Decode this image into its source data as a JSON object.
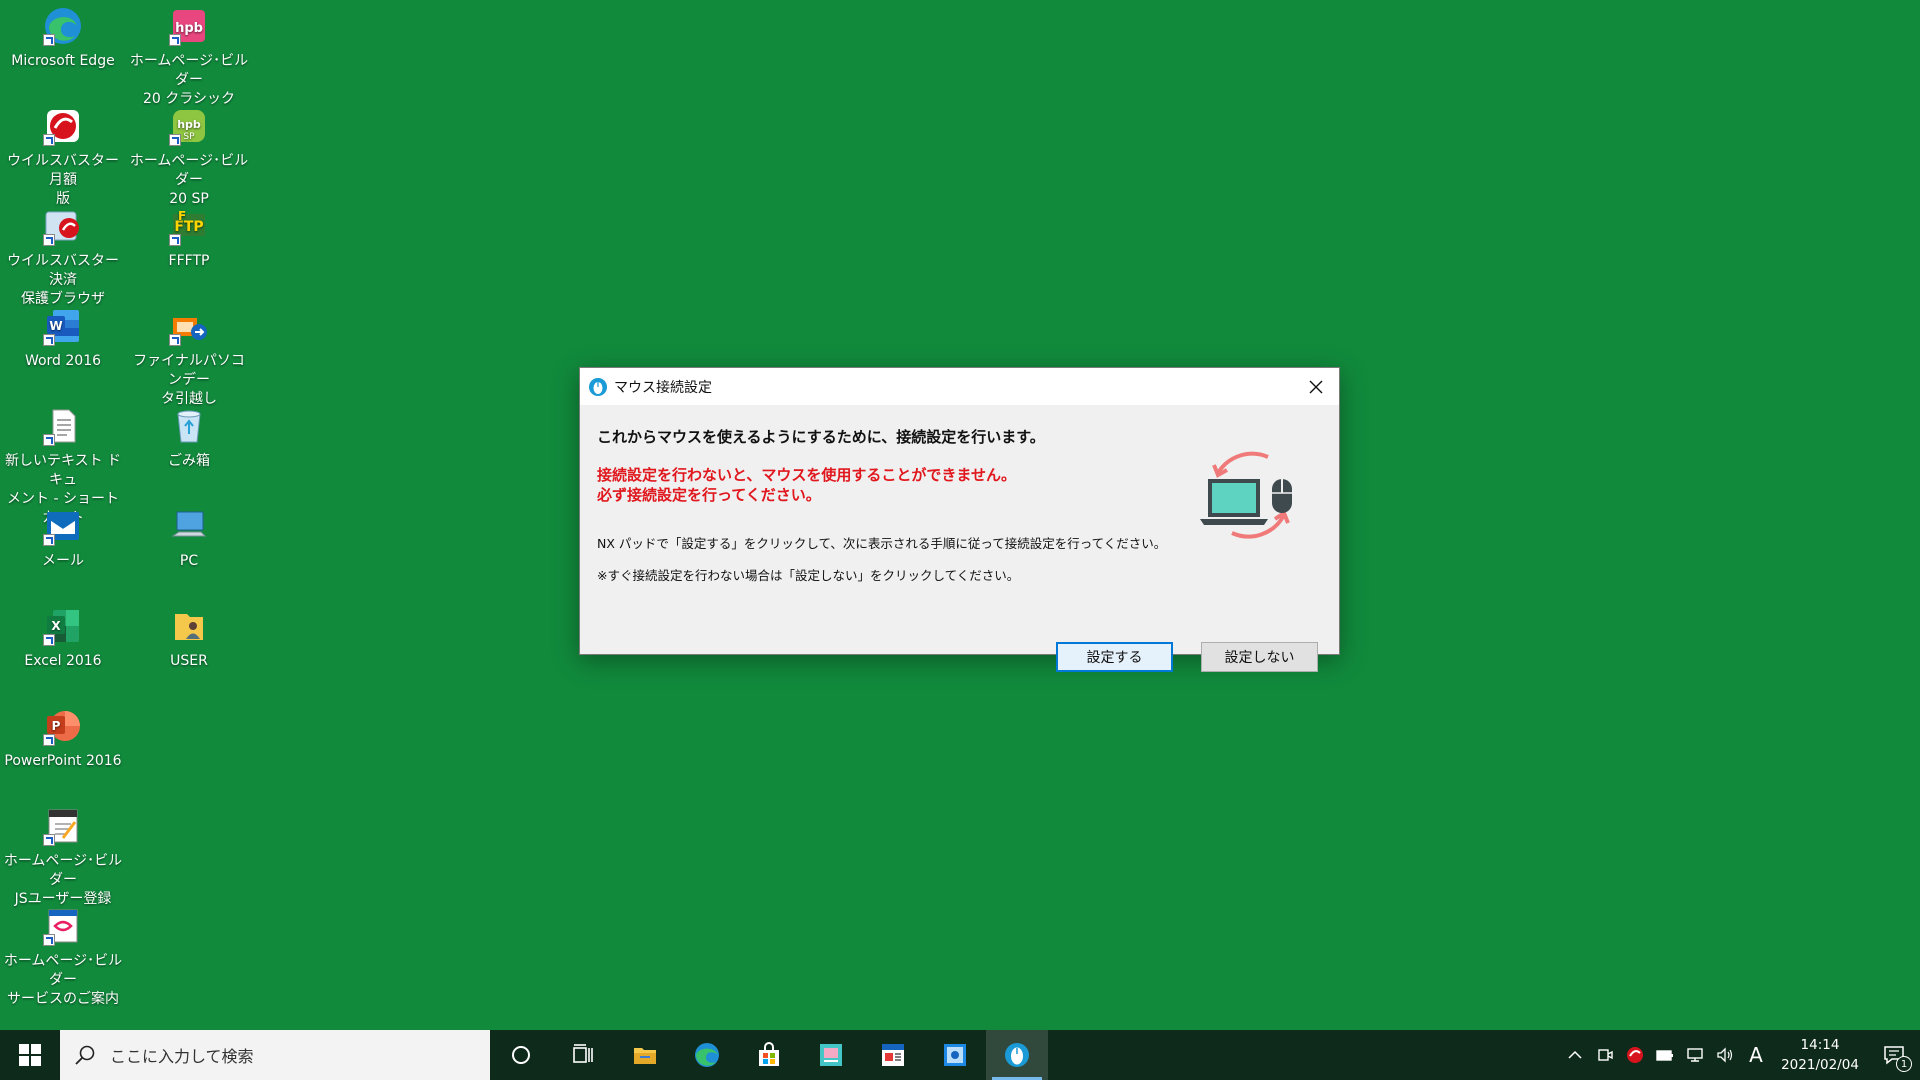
{
  "desktop": {
    "icons": [
      {
        "label": "Microsoft Edge",
        "icon": "edge-icon"
      },
      {
        "label": "ホームページ･ビルダー\n20 クラシック",
        "icon": "hpb-classic-icon"
      },
      {
        "label": "ウイルスバスター 月額\n版",
        "icon": "virusbuster-icon"
      },
      {
        "label": "ホームページ･ビルダー\n20 SP",
        "icon": "hpb-sp-icon"
      },
      {
        "label": "ウイルスバスター決済\n保護ブラウザ",
        "icon": "virusbuster-browser-icon"
      },
      {
        "label": "FFFTP",
        "icon": "ffftp-icon"
      },
      {
        "label": "Word 2016",
        "icon": "word-icon"
      },
      {
        "label": "ファイナルパソコンデー\nタ引越し",
        "icon": "final-pc-data-icon"
      },
      {
        "label": "新しいテキスト ドキュ\nメント - ショートカット",
        "icon": "text-document-icon"
      },
      {
        "label": "ごみ箱",
        "icon": "recycle-bin-icon"
      },
      {
        "label": "メール",
        "icon": "mail-icon"
      },
      {
        "label": "PC",
        "icon": "pc-icon"
      },
      {
        "label": "Excel 2016",
        "icon": "excel-icon"
      },
      {
        "label": "USER",
        "icon": "user-folder-icon"
      },
      {
        "label": "PowerPoint 2016",
        "icon": "powerpoint-icon"
      },
      {
        "label": "ホームページ･ビルダー\nJSユーザー登録",
        "icon": "hpb-js-register-icon"
      },
      {
        "label": "ホームページ･ビルダー\nサービスのご案内",
        "icon": "hpb-service-icon"
      }
    ]
  },
  "dialog": {
    "title": "マウス接続設定",
    "main_message": "これからマウスを使えるようにするために、接続設定を行います。",
    "warning_line1": "接続設定を行わないと、マウスを使用することができません。",
    "warning_line2": "必ず接続設定を行ってください。",
    "info_line1": "NX パッドで「設定する」をクリックして、次に表示される手順に従って接続設定を行ってください。",
    "info_line2": "※すぐ接続設定を行わない場合は「設定しない」をクリックしてください。",
    "button_set": "設定する",
    "button_no_set": "設定しない"
  },
  "taskbar": {
    "search_placeholder": "ここに入力して検索",
    "clock_time": "14:14",
    "clock_date": "2021/02/04",
    "ime": "A",
    "notification_count": "1"
  },
  "colors": {
    "desktop_bg": "#118a3c",
    "taskbar_bg": "#0e2a1b",
    "warning": "#e0181e",
    "accent": "#0078d7"
  }
}
